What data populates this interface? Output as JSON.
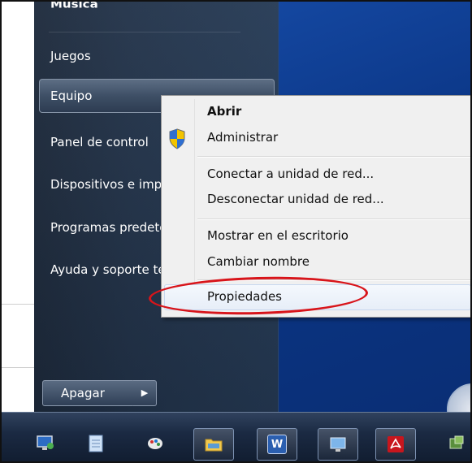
{
  "start_menu": {
    "items": [
      {
        "label": "Música"
      },
      {
        "label": "Juegos"
      },
      {
        "label": "Equipo"
      },
      {
        "label": "Panel de control"
      },
      {
        "label": "Dispositivos e impresoras"
      },
      {
        "label": "Programas predeterminados"
      },
      {
        "label": "Ayuda y soporte técnico"
      }
    ],
    "shutdown_label": "Apagar"
  },
  "context_menu": {
    "items": [
      {
        "label": "Abrir",
        "bold": true
      },
      {
        "label": "Administrar",
        "icon": "uac-shield-icon"
      },
      {
        "label": "Conectar a unidad de red..."
      },
      {
        "label": "Desconectar unidad de red..."
      },
      {
        "label": "Mostrar en el escritorio"
      },
      {
        "label": "Cambiar nombre"
      },
      {
        "label": "Propiedades",
        "highlighted": true
      }
    ]
  },
  "taskbar": {
    "buttons": [
      {
        "icon": "remote-desktop-icon"
      },
      {
        "icon": "notepad-icon"
      },
      {
        "icon": "paint-icon"
      },
      {
        "icon": "explorer-folder-icon"
      },
      {
        "icon": "word-icon",
        "glyph": "W"
      },
      {
        "icon": "remote-display-icon"
      },
      {
        "icon": "acrobat-icon"
      },
      {
        "icon": "app-icon"
      }
    ]
  },
  "colors": {
    "annotation_red": "#d8141a",
    "desktop_blue": "#0b3686"
  }
}
